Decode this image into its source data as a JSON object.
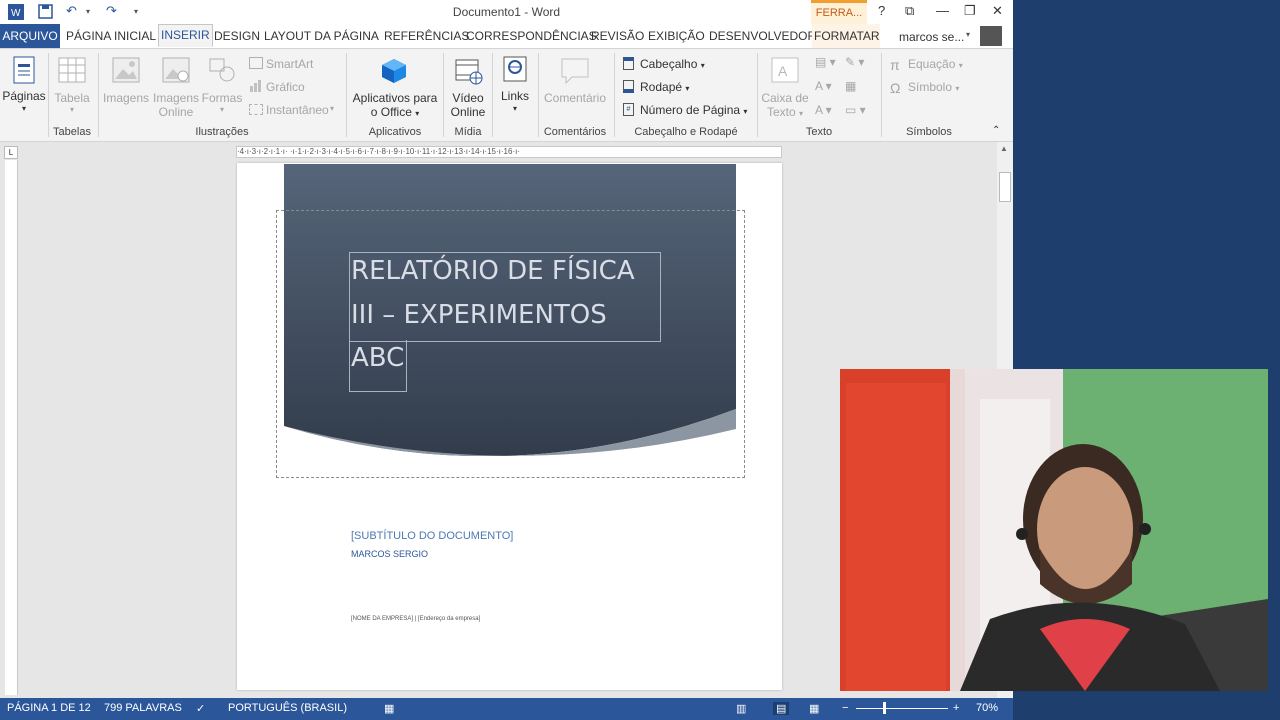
{
  "titlebar": {
    "document_title": "Documento1 - Word",
    "context_tab": "FERRA...",
    "help": "?",
    "restore_ribbon": "⧉",
    "minimize": "—",
    "maximize": "❐",
    "close": "✕"
  },
  "tabs": [
    "ARQUIVO",
    "PÁGINA INICIAL",
    "INSERIR",
    "DESIGN",
    "LAYOUT DA PÁGINA",
    "REFERÊNCIAS",
    "CORRESPONDÊNCIAS",
    "REVISÃO",
    "EXIBIÇÃO",
    "DESENVOLVEDOR",
    "FORMATAR"
  ],
  "active_tab": "INSERIR",
  "user_name": "marcos se...",
  "ribbon": {
    "paginas": "Páginas",
    "tabela": "Tabela",
    "imagens": "Imagens",
    "imagens_online_1": "Imagens",
    "imagens_online_2": "Online",
    "formas": "Formas",
    "smartart": "SmartArt",
    "grafico": "Gráfico",
    "instantaneo": "Instantâneo",
    "aplicativos_1": "Aplicativos para",
    "aplicativos_2": "o Office",
    "video_1": "Vídeo",
    "video_2": "Online",
    "links": "Links",
    "comentario": "Comentário",
    "cabecalho": "Cabeçalho",
    "rodape": "Rodapé",
    "numero_pagina": "Número de Página",
    "caixa_texto_1": "Caixa de",
    "caixa_texto_2": "Texto",
    "equacao": "Equação",
    "simbolo": "Símbolo",
    "groups": {
      "tabelas": "Tabelas",
      "ilustracoes": "Ilustrações",
      "aplicativos": "Aplicativos",
      "midia": "Mídia",
      "comentarios": "Comentários",
      "cabecalho_rodape": "Cabeçalho e Rodapé",
      "texto": "Texto",
      "simbolos": "Símbolos"
    }
  },
  "ruler_text": "·4·ı·3·ı·2·ı·1·ı· ·ı·1·ı·2·ı·3·ı·4·ı·5·ı·6·ı·7·ı·8·ı·9·ı·10·ı·11·ı·12·ı·13·ı·14·ı·15·ı·16·ı·",
  "document": {
    "title_line1": "RELATÓRIO DE FÍSICA",
    "title_line2": "III – EXPERIMENTOS",
    "title_line3": "ABC",
    "subtitle": "[SUBTÍTULO DO DOCUMENTO]",
    "author": "MARCOS SERGIO",
    "company": "[NOME DA EMPRESA] | [Endereço da empresa]"
  },
  "status": {
    "page": "PÁGINA 1 DE 12",
    "words": "799 PALAVRAS",
    "language": "PORTUGUÊS (BRASIL)",
    "zoom": "70%"
  },
  "colors": {
    "accent": "#2b579a",
    "cover_dark": "#3a4555",
    "cover_light": "#56657a",
    "swoosh": "#8c96a3",
    "context_tab": "#c55a11"
  }
}
